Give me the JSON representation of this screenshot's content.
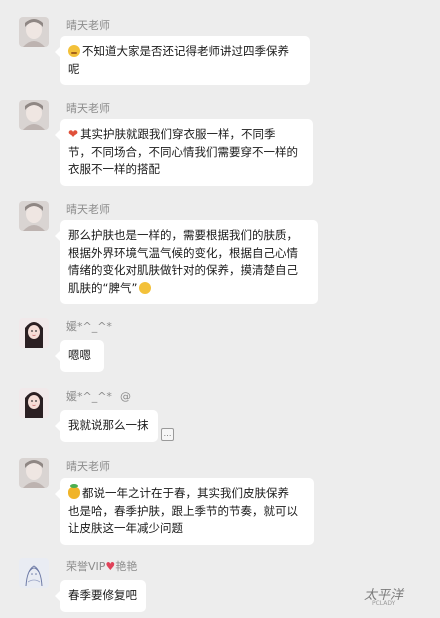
{
  "messages": [
    {
      "sender": "晴天老师",
      "emoji": "sweat-smile-emoji",
      "lines": [
        "不知道大家是否还记得老师讲过四季保养",
        "呢"
      ]
    },
    {
      "sender": "晴天老师",
      "emoji": "heart-emoji",
      "lines": [
        "其实护肤就跟我们穿衣服一样，不同季",
        "节，不同场合，不同心情我们需要穿不一样的",
        "衣服不一样的搭配"
      ]
    },
    {
      "sender": "晴天老师",
      "lines": [
        "那么护肤也是一样的，需要根据我们的肤质，",
        "根据外界环境气温气候的变化，根据自己心情",
        "情绪的变化对肌肤做针对的保养，摸清楚自己",
        "肌肤的“脾气”"
      ],
      "trailing_emoji": "wink-emoji"
    },
    {
      "sender": "媛*^_^*",
      "lines": [
        "嗯嗯"
      ]
    },
    {
      "sender": "媛*^_^*",
      "sender_suffix": "@",
      "lines": [
        "我就说那么一抹"
      ]
    },
    {
      "sender": "晴天老师",
      "emoji": "pineapple-emoji",
      "lines": [
        "都说一年之计在于春，其实我们皮肤保养",
        "也是哈，春季护肤，跟上季节的节奏，就可以",
        "让皮肤这一年减少问题"
      ]
    },
    {
      "sender_prefix": "荣誉VIP",
      "sender_heart": "♥",
      "sender": "艳艳",
      "lines": [
        "春季要修复吧"
      ]
    }
  ],
  "more_icon": "…",
  "watermark": {
    "text": "太平洋",
    "sub": "PCLADY"
  },
  "colors": {
    "background": "#ededed",
    "bubble": "#ffffff",
    "sender": "#8c8c8c"
  }
}
